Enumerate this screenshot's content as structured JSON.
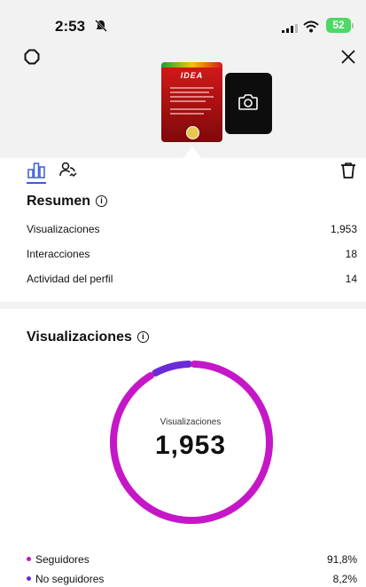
{
  "status_bar": {
    "time": "2:53",
    "battery": "52"
  },
  "summary": {
    "title": "Resumen",
    "rows": [
      {
        "label": "Visualizaciones",
        "value": "1,953"
      },
      {
        "label": "Interacciones",
        "value": "18"
      },
      {
        "label": "Actividad del perfil",
        "value": "14"
      }
    ]
  },
  "views": {
    "title": "Visualizaciones",
    "center_label": "Visualizaciones",
    "center_value": "1,953",
    "legend": [
      {
        "label": "Seguidores",
        "value": "91,8%",
        "color": "#c517c7"
      },
      {
        "label": "No seguidores",
        "value": "8,2%",
        "color": "#6a2ad8"
      }
    ]
  },
  "chart_data": {
    "type": "pie",
    "title": "Visualizaciones",
    "categories": [
      "Seguidores",
      "No seguidores"
    ],
    "values": [
      91.8,
      8.2
    ],
    "colors": [
      "#c517c7",
      "#6a2ad8"
    ]
  },
  "accent_color": "#3b5bdb"
}
